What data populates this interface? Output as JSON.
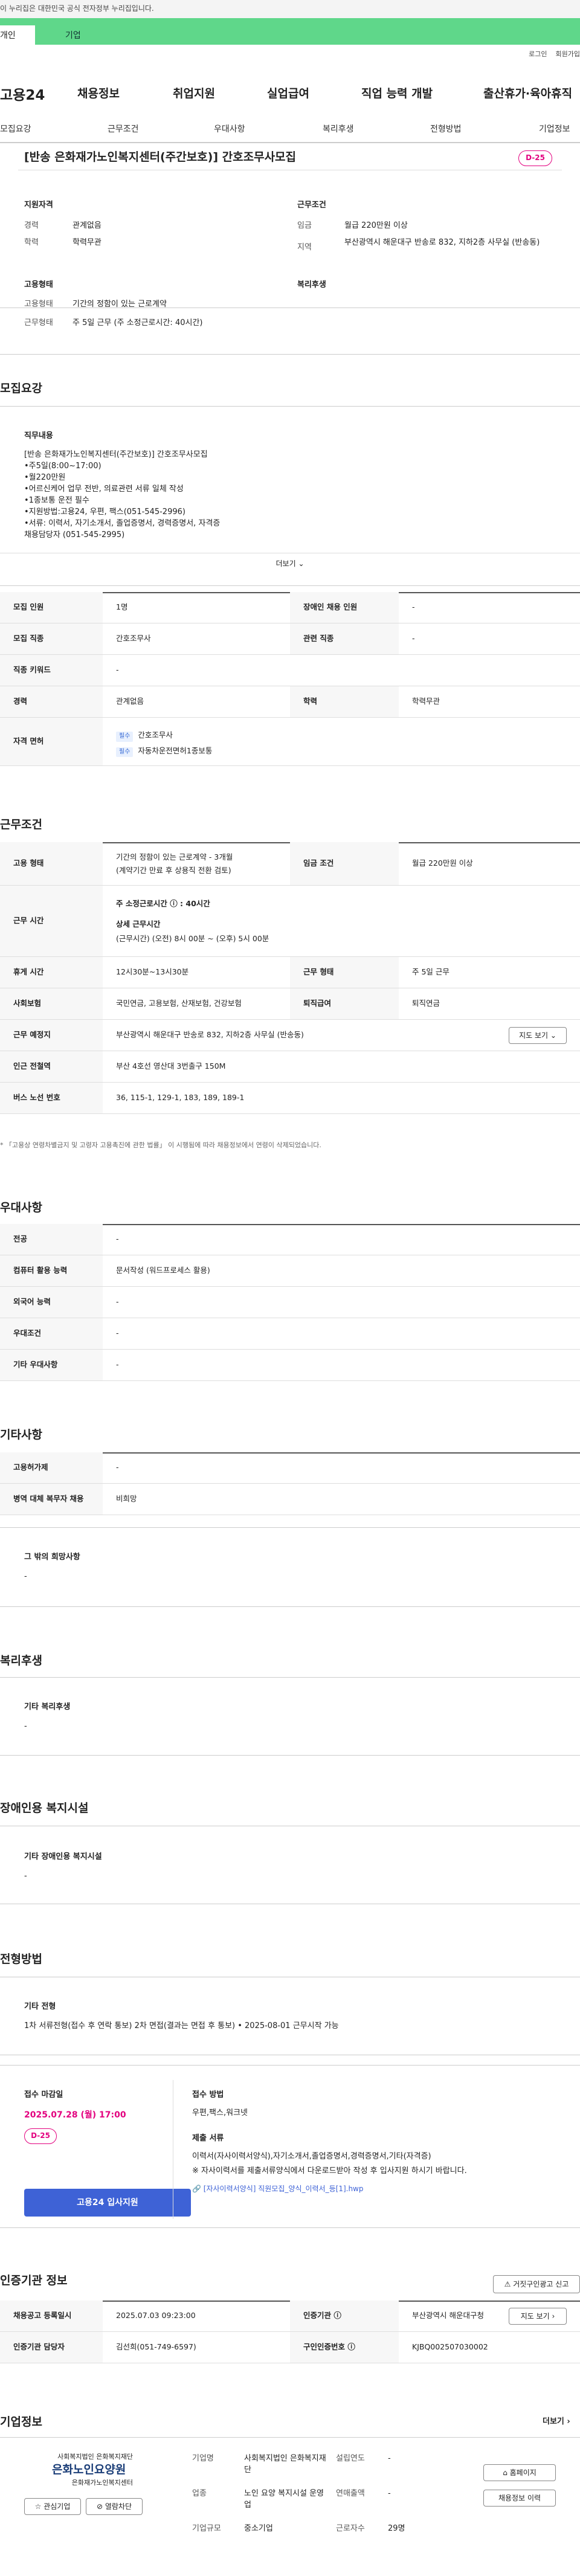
{
  "gov_notice": "이 누리집은 대한민국 공식 전자정부 누리집입니다.",
  "top_tabs": [
    "개인",
    "기업"
  ],
  "util": [
    "로그인",
    "회원가입"
  ],
  "logo": "고용24",
  "gnb": [
    "채용정보",
    "취업지원",
    "실업급여",
    "직업 능력 개발",
    "출산휴가·육아휴직"
  ],
  "snb": [
    "모집요강",
    "근무조건",
    "우대사항",
    "복리후생",
    "전형방법",
    "기업정보"
  ],
  "job": {
    "title": "[반송 은화재가노인복지센터(주간보호)] 간호조무사모집",
    "dday": "D-25",
    "qual_h": "지원자격",
    "qual": [
      [
        "경력",
        "관계없음"
      ],
      [
        "학력",
        "학력무관"
      ]
    ],
    "cond_h": "근무조건",
    "cond": [
      [
        "임금",
        "월급 220만원 이상"
      ],
      [
        "지역",
        "부산광역시 해운대구 반송로 832, 지하2층 사무실 (반송동)"
      ]
    ],
    "emp_h": "고용형태",
    "emp": [
      [
        "고용형태",
        "기간의 정함이 있는 근로계약"
      ],
      [
        "근무형태",
        "주 5일 근무 (주 소정근로시간: 40시간)"
      ]
    ],
    "welfare_h": "복리후생"
  },
  "req": {
    "h": "모집요강",
    "duty_h": "직무내용",
    "duty": [
      "[반송 은화재가노인복지센터(주간보호)] 간호조무사모집",
      "•주5일(8:00~17:00)",
      "•월220만원",
      "•어르신케어 업무 전반, 의료관련 서류 일체 작성",
      "•1종보통 운전 필수",
      "•지원방법:고용24, 우편, 팩스(051-545-2996)",
      "•서류: 이력서, 자기소개서, 졸업증명서, 경력증명서, 자격증",
      "채용담당자 (051-545-2995)"
    ],
    "more": "더보기",
    "rows": [
      [
        "모집 인원",
        "1명",
        "장애인 채용 인원",
        "-"
      ],
      [
        "모집 직종",
        "간호조무사",
        "관련 직종",
        "-"
      ],
      [
        "직종 키워드",
        "-",
        "",
        ""
      ],
      [
        "경력",
        "관계없음",
        "학력",
        "학력무관"
      ]
    ],
    "license_h": "자격 면허",
    "licenses": [
      [
        "필수",
        "간호조무사"
      ],
      [
        "필수",
        "자동차운전면허1종보통"
      ]
    ]
  },
  "work": {
    "h": "근무조건",
    "emp_type_h": "고용 형태",
    "emp_type": "기간의 정함이 있는 근로계약 - 3개월",
    "emp_type_sub": "(계약기간 만료 후 상용직 전환 검토)",
    "wage_h": "임금 조건",
    "wage": "월급 220만원 이상",
    "hours_h": "근무 시간",
    "hours_main": "주 소정근로시간 ⓘ : 40시간",
    "hours_detail_h": "상세 근무시간",
    "hours_detail": "(근무시간) (오전) 8시 00분 ~ (오후) 5시 00분",
    "rows": [
      [
        "휴게 시간",
        "12시30분~13시30분",
        "근무 형태",
        "주 5일 근무"
      ],
      [
        "사회보험",
        "국민연금, 고용보험, 산재보험, 건강보험",
        "퇴직급여",
        "퇴직연금"
      ]
    ],
    "place_h": "근무 예정지",
    "place": "부산광역시 해운대구 반송로 832, 지하2층 사무실 (반송동)",
    "map": "지도 보기",
    "subway_h": "인근 전철역",
    "subway": "부산 4호선 영산대 3번출구 150M",
    "bus_h": "버스 노선 번호",
    "bus": "36, 115-1, 129-1, 183, 189, 189-1",
    "note": "* 「고용상 연령차별금지 및 고령자 고용촉진에 관한 법률」 이 시행됨에 따라 채용정보에서 연령이 삭제되었습니다."
  },
  "pref": {
    "h": "우대사항",
    "rows": [
      [
        "전공",
        "-"
      ],
      [
        "컴퓨터 활용 능력",
        "문서작성 (워드프로세스 활용)"
      ],
      [
        "외국어 능력",
        "-"
      ],
      [
        "우대조건",
        "-"
      ],
      [
        "기타 우대사항",
        "-"
      ]
    ]
  },
  "etc": {
    "h": "기타사항",
    "rows": [
      [
        "고용허가제",
        "-"
      ],
      [
        "병역 대체 복무자 채용",
        "비희망"
      ]
    ],
    "other_h": "그 밖의 희망사항",
    "other": "-"
  },
  "welfare": {
    "h": "복리후생",
    "sub_h": "기타 복리후생",
    "val": "-"
  },
  "disab": {
    "h": "장애인용 복지시설",
    "sub_h": "기타 장애인용 복지시설",
    "val": "-"
  },
  "sel": {
    "h": "전형방법",
    "kind_h": "기타 전형",
    "kind": "1차 서류전형(접수 후 연락 통보) 2차 면접(결과는 면접 후 통보) • 2025-08-01 근무시작 가능",
    "deadline_h": "접수 마감일",
    "deadline": "2025.07.28 (월) 17:00",
    "dday": "D-25",
    "apply": "고용24 입사지원",
    "method_h": "접수 방법",
    "method": "우편,팩스,워크넷",
    "docs_h": "제출 서류",
    "docs": "이력서(자사이력서양식),자기소개서,졸업증명서,경력증명서,기타(자격증)",
    "docs_note": "※ 자사이력서를 제출서류양식에서 다운로드받아 작성 후 입사지원 하시기 바랍니다.",
    "file": "[자사이력서양식] 직원모집_양식_이력서_등[1].hwp"
  },
  "cert": {
    "h": "인증기관 정보",
    "report": "거짓구인광고 신고",
    "rows": [
      [
        "채용공고 등록일시",
        "2025.07.03 09:23:00",
        "인증기관 ⓘ",
        "부산광역시 해운대구청"
      ],
      [
        "인증기관 담당자",
        "김선희(051-749-6597)",
        "구인인증번호 ⓘ",
        "KJBQ002507030002"
      ]
    ],
    "map": "지도 보기"
  },
  "comp": {
    "h": "기업정보",
    "more": "더보기",
    "logo1": "사회복지법인 은화복지재단",
    "logo2": "은화노인요양원",
    "logo3": "은화재가노인복지센터",
    "fav": "관심기업",
    "block": "열람차단",
    "rows": [
      [
        "기업명",
        "사회복지법인 은화복지재단",
        "설립연도",
        "-"
      ],
      [
        "업종",
        "노인 요양 복지시설 운영업",
        "연매출액",
        "-"
      ],
      [
        "기업규모",
        "중소기업",
        "근로자수",
        "29명"
      ]
    ],
    "home": "홈페이지",
    "history": "채용정보 이력"
  },
  "colors": {
    "accent": "#e3007f",
    "green": "#5fd78a",
    "blue": "#3e62d6"
  }
}
